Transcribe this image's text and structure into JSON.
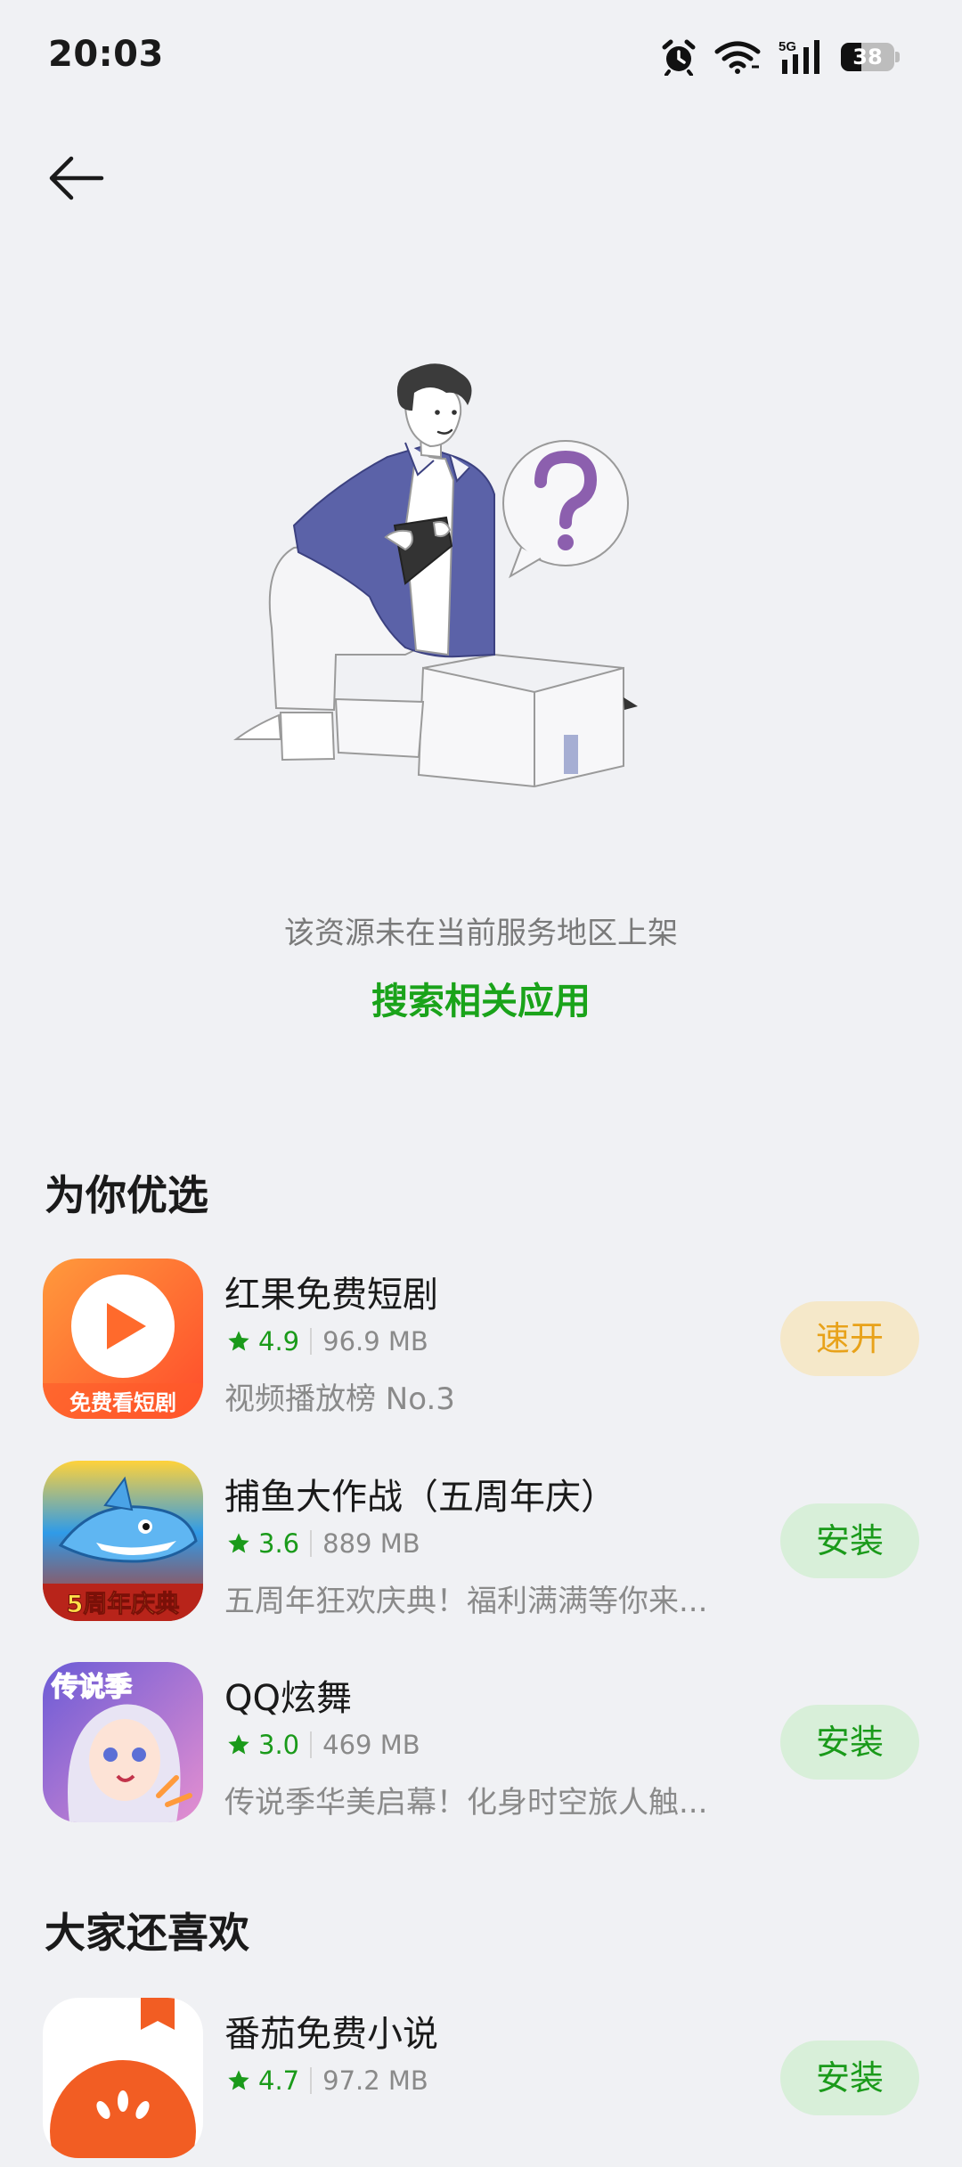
{
  "status_bar": {
    "time": "20:03",
    "network": "5G",
    "battery": "38",
    "battery_level": 0.38
  },
  "empty_state": {
    "message": "该资源未在当前服务地区上架",
    "action_label": "搜索相关应用"
  },
  "sections": [
    {
      "title": "为你优选",
      "apps": [
        {
          "name": "红果免费短剧",
          "rating": "4.9",
          "size": "96.9 MB",
          "desc": "视频播放榜 No.3",
          "button": "速开",
          "icon_text": "免费看短剧"
        },
        {
          "name": "捕鱼大作战（五周年庆）",
          "rating": "3.6",
          "size": "889 MB",
          "desc": "五周年狂欢庆典！福利满满等你来...",
          "button": "安装",
          "icon_text": "5周年庆典"
        },
        {
          "name": "QQ炫舞",
          "rating": "3.0",
          "size": "469 MB",
          "desc": "传说季华美启幕！化身时空旅人触...",
          "button": "安装",
          "icon_text": "传说季"
        }
      ]
    },
    {
      "title": "大家还喜欢",
      "apps": [
        {
          "name": "番茄免费小说",
          "rating": "4.7",
          "size": "97.2 MB",
          "desc": "",
          "button": "安装"
        }
      ]
    }
  ],
  "colors": {
    "background": "#f0f1f4",
    "accent_green": "#1aa31a",
    "install_bg": "#d8efd9",
    "open_bg": "#f5e8c9",
    "open_text": "#e8a21a",
    "illustration_jacket": "#5b62a8",
    "illustration_question": "#8c5fae"
  },
  "icons": [
    "alarm-icon",
    "wifi-icon",
    "signal-icon",
    "battery-icon",
    "back-arrow-icon",
    "star-icon"
  ]
}
